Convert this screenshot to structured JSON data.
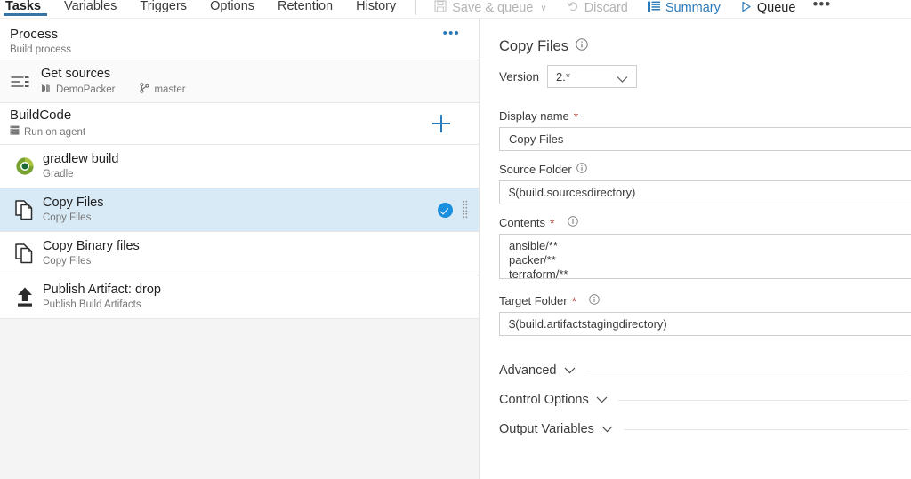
{
  "tabs": [
    {
      "label": "Tasks",
      "active": true
    },
    {
      "label": "Variables",
      "active": false
    },
    {
      "label": "Triggers",
      "active": false
    },
    {
      "label": "Options",
      "active": false
    },
    {
      "label": "Retention",
      "active": false
    },
    {
      "label": "History",
      "active": false
    }
  ],
  "toolbar": {
    "save_queue_label": "Save & queue",
    "discard_label": "Discard",
    "summary_label": "Summary",
    "queue_label": "Queue",
    "overflow_label": "•••",
    "caret": "∨"
  },
  "left": {
    "process": {
      "title": "Process",
      "subtitle": "Build process",
      "overflow_label": "•••"
    },
    "get_sources": {
      "title": "Get sources",
      "repo": "DemoPacker",
      "branch": "master"
    },
    "phase": {
      "title": "BuildCode",
      "subtitle": "Run on agent"
    },
    "tasks": [
      {
        "title": "gradlew build",
        "subtitle": "Gradle",
        "icon": "gradle-icon",
        "selected": false,
        "checked": false
      },
      {
        "title": "Copy Files",
        "subtitle": "Copy Files",
        "icon": "copy-files-icon",
        "selected": true,
        "checked": true
      },
      {
        "title": "Copy Binary files",
        "subtitle": "Copy Files",
        "icon": "copy-files-icon",
        "selected": false,
        "checked": false
      },
      {
        "title": "Publish Artifact: drop",
        "subtitle": "Publish Build Artifacts",
        "icon": "publish-artifact-icon",
        "selected": false,
        "checked": false
      }
    ]
  },
  "detail": {
    "title": "Copy Files",
    "version_label": "Version",
    "version_value": "2.*",
    "fields": [
      {
        "label": "Display name",
        "required": true,
        "info": false,
        "value": "Copy Files",
        "type": "text",
        "name": "display-name-field"
      },
      {
        "label": "Source Folder",
        "required": false,
        "info": true,
        "value": "$(build.sourcesdirectory)",
        "type": "text",
        "name": "source-folder-field"
      },
      {
        "label": "Contents",
        "required": true,
        "info": true,
        "value": "ansible/**\npacker/**\nterraform/**",
        "type": "textarea",
        "name": "contents-field"
      },
      {
        "label": "Target Folder",
        "required": true,
        "info": true,
        "value": "$(build.artifactstagingdirectory)",
        "type": "text",
        "name": "target-folder-field"
      }
    ],
    "sections": [
      {
        "label": "Advanced",
        "name": "section-advanced"
      },
      {
        "label": "Control Options",
        "name": "section-control-options"
      },
      {
        "label": "Output Variables",
        "name": "section-output-variables"
      }
    ]
  },
  "colors": {
    "accent_blue": "#2a7ab9",
    "tab_underline": "#3574a5",
    "selected_row": "#d9eaf7",
    "check_badge": "#1a8fdd",
    "required_red": "#b4544d",
    "gradle_green": "#78a22f",
    "gradle_dark_green": "#1a6b33"
  }
}
